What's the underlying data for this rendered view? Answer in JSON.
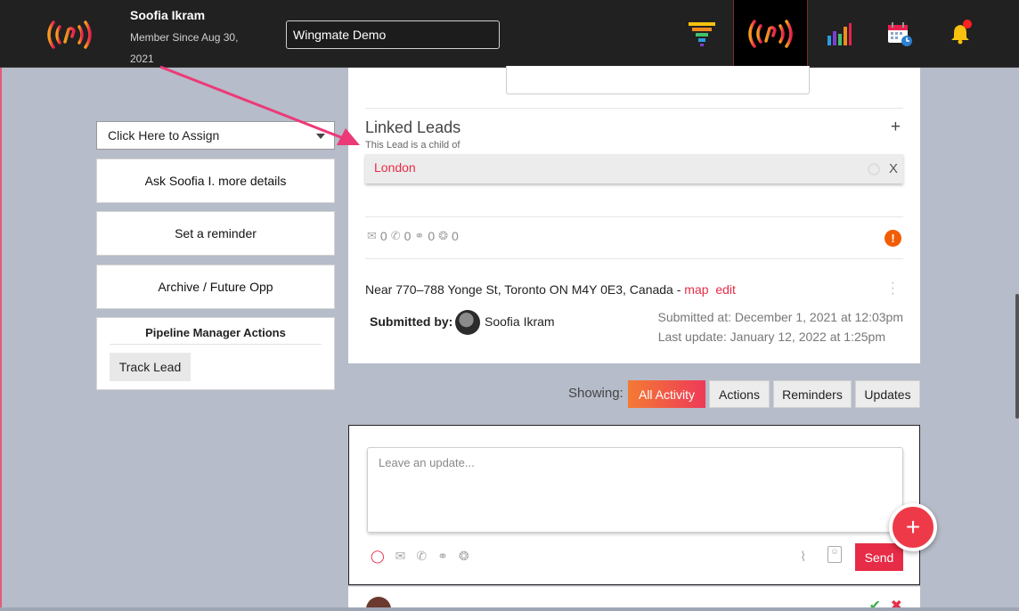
{
  "header": {
    "user_name": "Soofia Ikram",
    "member_since": "Member Since Aug 30, 2021",
    "company_value": "Wingmate Demo",
    "icons": [
      "funnel-icon",
      "wingmate-signal-icon",
      "bar-chart-icon",
      "calendar-icon",
      "bell-icon"
    ]
  },
  "sidebar": {
    "assign_select": "Click Here to Assign",
    "ask_details": "Ask Soofia I. more details",
    "set_reminder": "Set a reminder",
    "archive": "Archive / Future Opp",
    "pipeline_title": "Pipeline Manager Actions",
    "track_lead": "Track Lead"
  },
  "lead": {
    "linked_title": "Linked Leads",
    "add": "+",
    "child_of": "This Lead is a child of",
    "linked_name": "London",
    "remove": "X",
    "counts": {
      "email": "0",
      "call": "0",
      "meeting": "0",
      "other": "0"
    },
    "alert": "!",
    "address": "Near 770–788 Yonge St, Toronto ON M4Y 0E3, Canada - ",
    "map_link": "map",
    "edit_link": "edit",
    "submitted_by_label": "Submitted by:",
    "submitted_by_name": "Soofia Ikram",
    "submitted_at": "Submitted at: December 1, 2021 at 12:03pm",
    "last_update": "Last update: January 12, 2022 at 1:25pm"
  },
  "activity_filter": {
    "label": "Showing:",
    "tabs": [
      "All Activity",
      "Actions",
      "Reminders",
      "Updates"
    ],
    "active": "All Activity"
  },
  "composer": {
    "placeholder": "Leave an update...",
    "send": "Send",
    "fab": "+"
  },
  "colors": {
    "accent": "#e62c46",
    "topbar": "#212121",
    "background": "#b6bcc9",
    "alert": "#f25c05"
  }
}
